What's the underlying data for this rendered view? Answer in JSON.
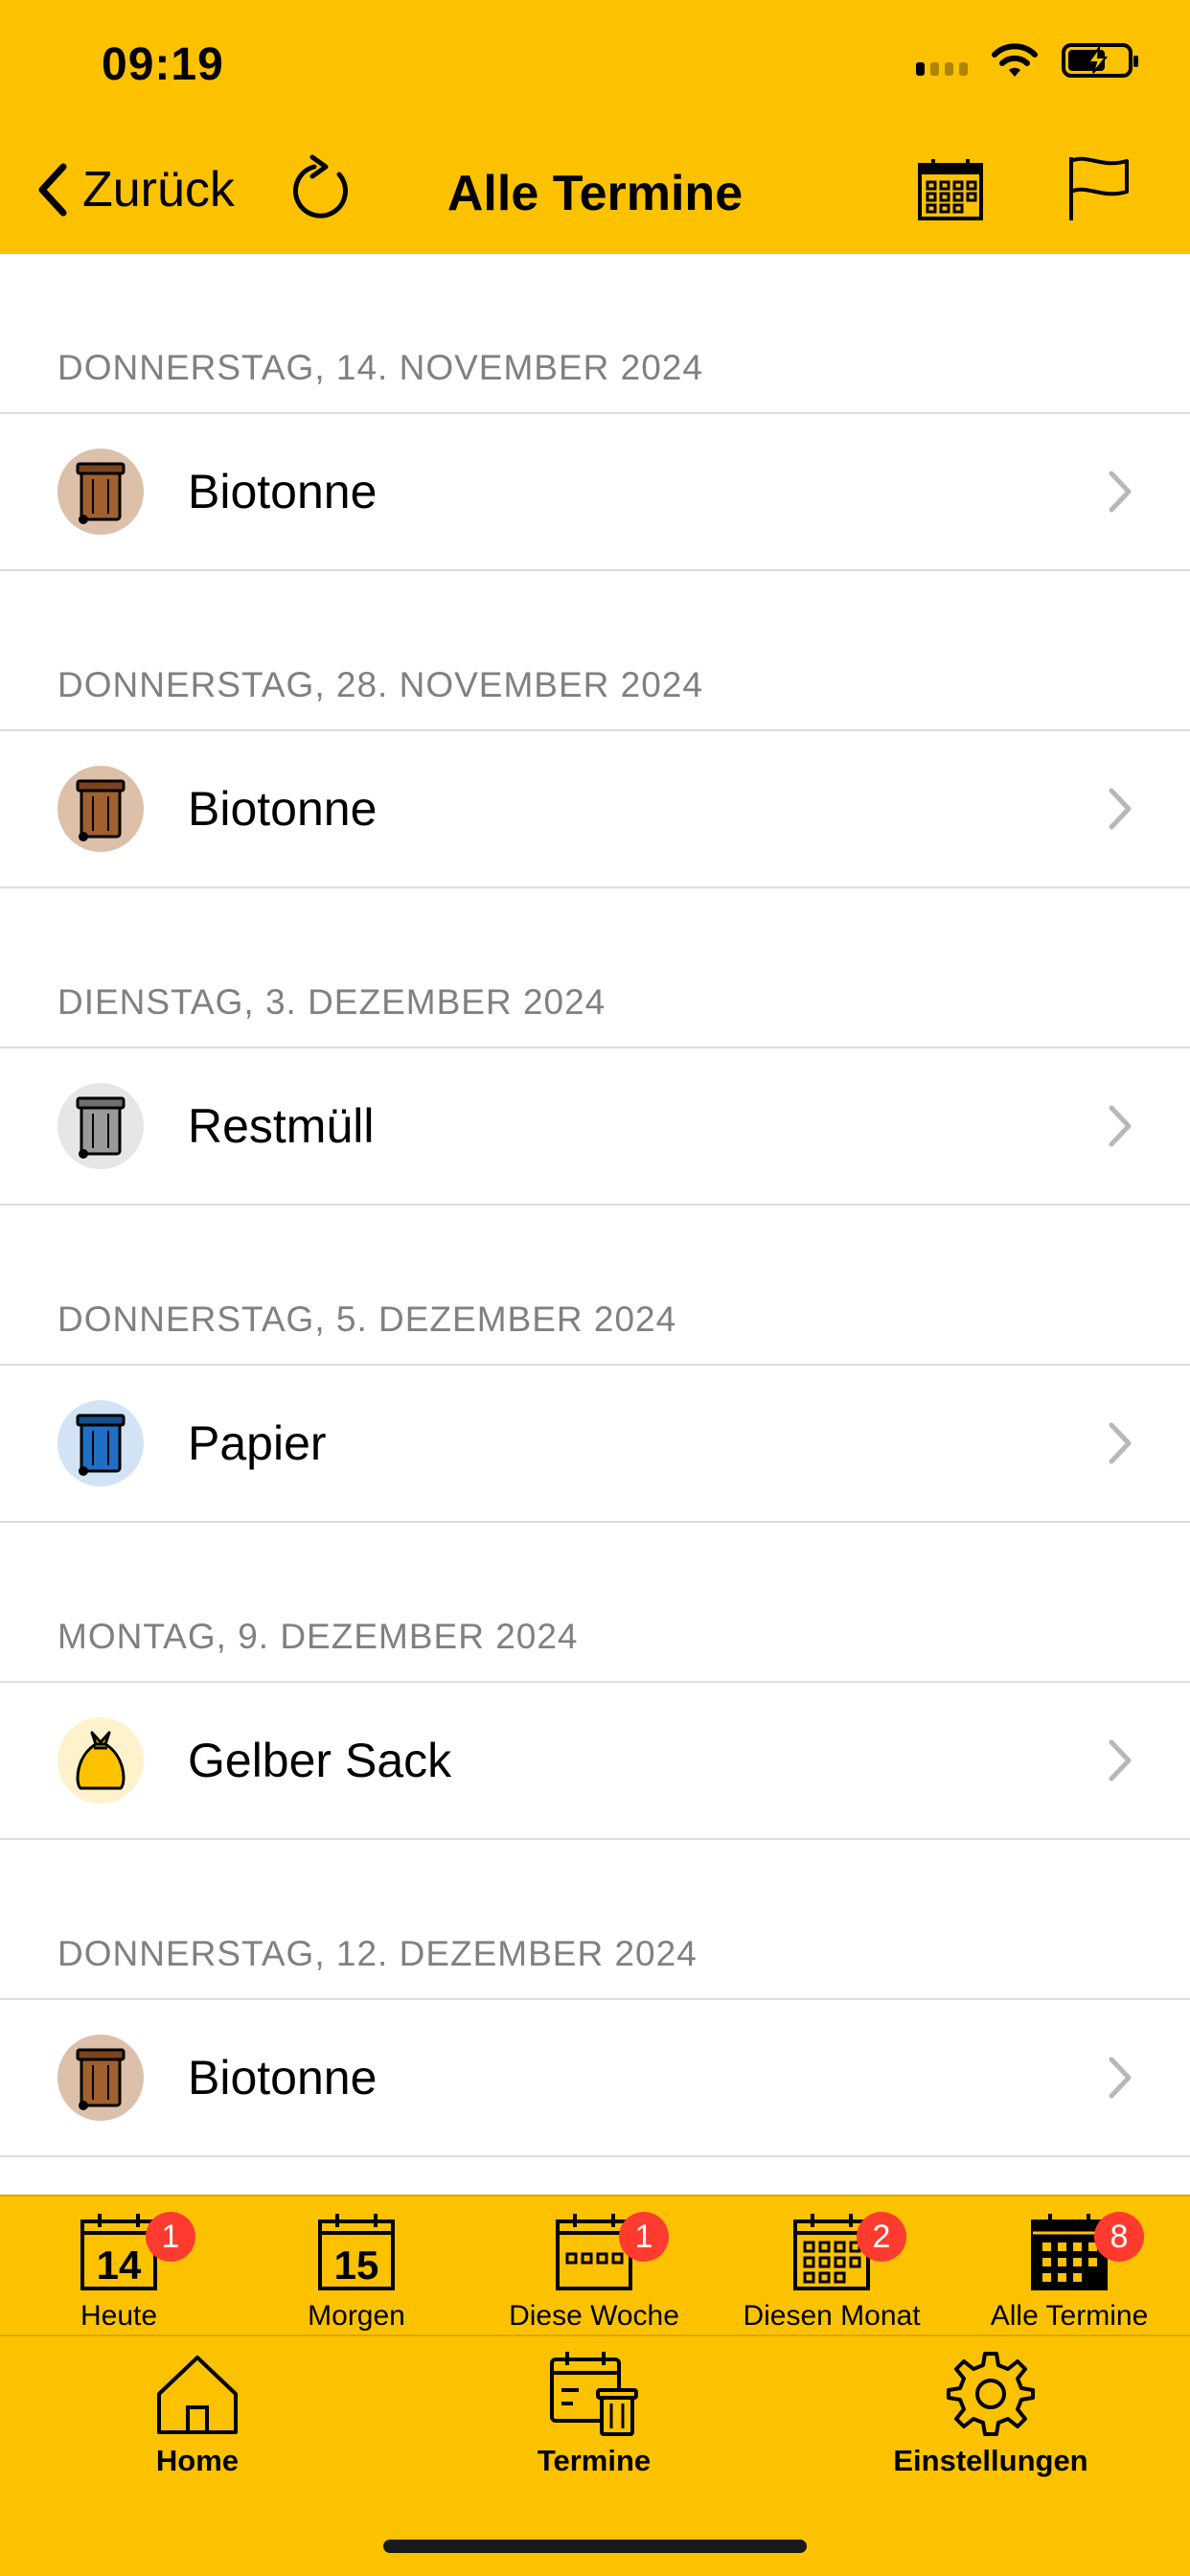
{
  "status_bar": {
    "time": "09:19"
  },
  "nav": {
    "back_label": "Zurück",
    "title": "Alle Termine"
  },
  "colors": {
    "accent": "#FCC200",
    "badge": "#FF3B30",
    "bio": "#A0602F",
    "rest": "#9A9A9A",
    "papier": "#1F6FC5",
    "gelb": "#FCC200"
  },
  "entries": [
    {
      "date": "DONNERSTAG, 14. NOVEMBER 2024",
      "label": "Biotonne",
      "icon": "brown-bin-icon"
    },
    {
      "date": "DONNERSTAG, 28. NOVEMBER 2024",
      "label": "Biotonne",
      "icon": "brown-bin-icon"
    },
    {
      "date": "DIENSTAG, 3. DEZEMBER 2024",
      "label": "Restmüll",
      "icon": "grey-bin-icon"
    },
    {
      "date": "DONNERSTAG, 5. DEZEMBER 2024",
      "label": "Papier",
      "icon": "blue-bin-icon"
    },
    {
      "date": "MONTAG, 9. DEZEMBER 2024",
      "label": "Gelber Sack",
      "icon": "yellow-bag-icon"
    },
    {
      "date": "DONNERSTAG, 12. DEZEMBER 2024",
      "label": "Biotonne",
      "icon": "brown-bin-icon"
    }
  ],
  "subtabs": [
    {
      "label": "Heute",
      "icon_number": "14",
      "badge": "1"
    },
    {
      "label": "Morgen",
      "icon_number": "15",
      "badge": ""
    },
    {
      "label": "Diese Woche",
      "badge": "1"
    },
    {
      "label": "Diesen Monat",
      "badge": "2"
    },
    {
      "label": "Alle Termine",
      "badge": "8"
    }
  ],
  "maintabs": [
    {
      "label": "Home"
    },
    {
      "label": "Termine"
    },
    {
      "label": "Einstellungen"
    }
  ]
}
